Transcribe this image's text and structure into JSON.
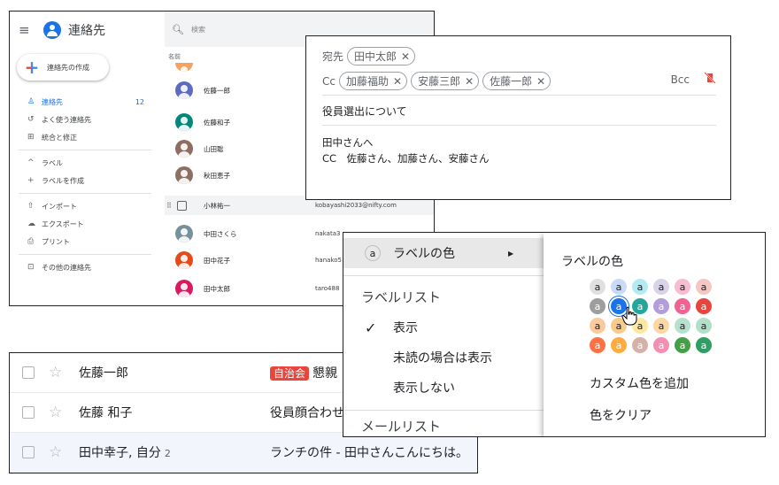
{
  "contacts": {
    "app_title": "連絡先",
    "create_label": "連絡先の作成",
    "nav": [
      {
        "label": "連絡先",
        "count": "12",
        "icon": "person-icon"
      },
      {
        "label": "よく使う連絡先",
        "icon": "history-icon"
      },
      {
        "label": "統合と修正",
        "icon": "merge-icon"
      }
    ],
    "labels_section": "ラベル",
    "create_label_nav": "ラベルを作成",
    "nav2": [
      {
        "label": "インポート",
        "icon": "upload-icon"
      },
      {
        "label": "エクスポート",
        "icon": "cloud-download-icon"
      },
      {
        "label": "プリント",
        "icon": "print-icon"
      }
    ],
    "other_contacts": "その他の連絡先",
    "search_placeholder": "検索",
    "column_name": "名前",
    "rows": [
      {
        "name": "佐藤一郎",
        "email": "",
        "color": "#5c6bc0"
      },
      {
        "name": "佐藤和子",
        "email": "",
        "color": "#00897b"
      },
      {
        "name": "山田聡",
        "email": "",
        "color": "#8d6e63"
      },
      {
        "name": "秋田恵子",
        "email": "",
        "color": "#8d6e63"
      },
      {
        "name": "小林祐一",
        "email": "kobayashi2033@nifty.com",
        "color": "#ffffff"
      },
      {
        "name": "中田さくら",
        "email": "nakata3",
        "color": "#78909c"
      },
      {
        "name": "田中花子",
        "email": "hanako5",
        "color": "#e64a19"
      },
      {
        "name": "田中太郎",
        "email": "taro488",
        "color": "#d81b60"
      }
    ]
  },
  "compose": {
    "to_label": "宛先",
    "to_chips": [
      "田中太郎"
    ],
    "cc_label": "Cc",
    "cc_chips": [
      "加藤福助",
      "安藤三郎",
      "佐藤一郎"
    ],
    "bcc": "Bcc",
    "subject": "役員選出について",
    "body_line1": "田中さんへ",
    "body_line2": "CC　佐藤さん、加藤さん、安藤さん"
  },
  "maillist": {
    "rows": [
      {
        "sender": "佐藤一郎",
        "count": "",
        "tag": "自治会",
        "subject": "懇親"
      },
      {
        "sender": "佐藤 和子",
        "count": "",
        "tag": "",
        "subject": "役員顔合わせ"
      },
      {
        "sender": "田中幸子, 自分",
        "count": "2",
        "tag": "",
        "subject": "ランチの件 - 田中さんこんにちは。"
      }
    ]
  },
  "labelmenu": {
    "label_color": "ラベルの色",
    "label_list_section": "ラベルリスト",
    "show": "表示",
    "show_if_unread": "未読の場合は表示",
    "hide": "表示しない",
    "mail_list_section": "メールリスト",
    "submenu_title": "ラベルの色",
    "add_custom_color": "カスタム色を追加",
    "clear_color": "色をクリア",
    "swatch_letter": "a",
    "swatch_rows": [
      [
        "#e0e0e0",
        "#c9daf8",
        "#b2ebf2",
        "#d9d2e9",
        "#f8bbd0",
        "#f4c7c3"
      ],
      [
        "#9e9e9e",
        "#1a73e8",
        "#26a69a",
        "#b39ddb",
        "#f06292",
        "#e8453c"
      ],
      [
        "#fbc99b",
        "#f7cb8e",
        "#fce8a0",
        "#fdd6a4",
        "#b7e1cd",
        "#b2dfc8"
      ],
      [
        "#ff7043",
        "#ffab40",
        "#d7b1a8",
        "#f48fb1",
        "#43a047",
        "#2e9e64"
      ]
    ]
  }
}
